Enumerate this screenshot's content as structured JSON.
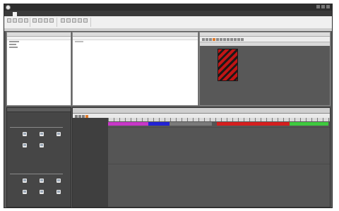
{
  "window": {
    "title": ""
  },
  "menu": {
    "tabs": [
      "",
      "",
      "",
      ""
    ],
    "active_index": 0
  },
  "panels": {
    "explorer": {
      "header": ""
    },
    "media": {
      "header": ""
    },
    "preview": {
      "header": ""
    },
    "tools": {
      "header": "",
      "section1": "",
      "section2": "",
      "tool_labels": [
        "",
        "",
        "",
        "",
        "",
        "",
        "",
        "",
        "",
        ""
      ]
    },
    "timeline": {
      "header": ""
    }
  },
  "colors": {
    "clip_magenta": "#c837c8",
    "clip_blue": "#2323d4",
    "clip_red": "#d41f1f",
    "clip_green": "#3fca3f",
    "preview_stripe_red": "#c11515",
    "accent_orange": "#e07a2a"
  },
  "icons": {
    "app": "app-logo-icon",
    "tool": "tool-icon",
    "ribbon": "ribbon-button-icon"
  }
}
